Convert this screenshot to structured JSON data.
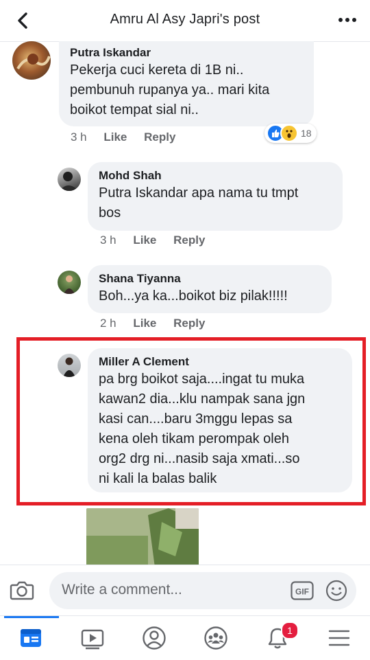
{
  "header": {
    "title": "Amru Al Asy Japri's post",
    "back_icon": "chevron-left-icon",
    "more_icon": "more-dots-icon"
  },
  "comments": [
    {
      "author": "Putra Iskandar",
      "text": "Pekerja cuci kereta di 1B ni..\npembunuh rupanya ya.. mari kita\nboikot tempat sial ni..",
      "time": "3 h",
      "like": "Like",
      "reply": "Reply",
      "reactions": {
        "icons": [
          "like-reaction-icon",
          "wow-reaction-icon"
        ],
        "count": "18"
      }
    },
    {
      "author": "Mohd Shah",
      "text": "Putra Iskandar apa nama tu tmpt\nbos",
      "time": "3 h",
      "like": "Like",
      "reply": "Reply"
    },
    {
      "author": "Shana Tiyanna",
      "text": "Boh...ya ka...boikot biz pilak!!!!!",
      "time": "2 h",
      "like": "Like",
      "reply": "Reply"
    },
    {
      "author": "Miller A Clement",
      "text": "pa brg boikot saja....ingat tu muka\nkawan2 dia...klu nampak sana jgn\nkasi can....baru 3mggu lepas sa\nkena oleh tikam perompak oleh\norg2 drg ni...nasib saja xmati...so\nni kali la balas balik"
    }
  ],
  "composer": {
    "placeholder": "Write a comment...",
    "camera_icon": "camera-icon",
    "gif_label": "GIF",
    "emoji_icon": "smiley-icon"
  },
  "tabbar": {
    "tabs": [
      {
        "name": "news-feed-icon",
        "active": true
      },
      {
        "name": "watch-icon",
        "active": false
      },
      {
        "name": "profile-icon",
        "active": false
      },
      {
        "name": "groups-icon",
        "active": false
      },
      {
        "name": "notifications-bell-icon",
        "active": false,
        "badge": "1"
      },
      {
        "name": "menu-icon",
        "active": false
      }
    ]
  },
  "colors": {
    "accent": "#1877f2",
    "highlight_border": "#e41e26",
    "bubble_bg": "#f0f2f5",
    "meta_text": "#65676b",
    "badge": "#e41e3f"
  }
}
